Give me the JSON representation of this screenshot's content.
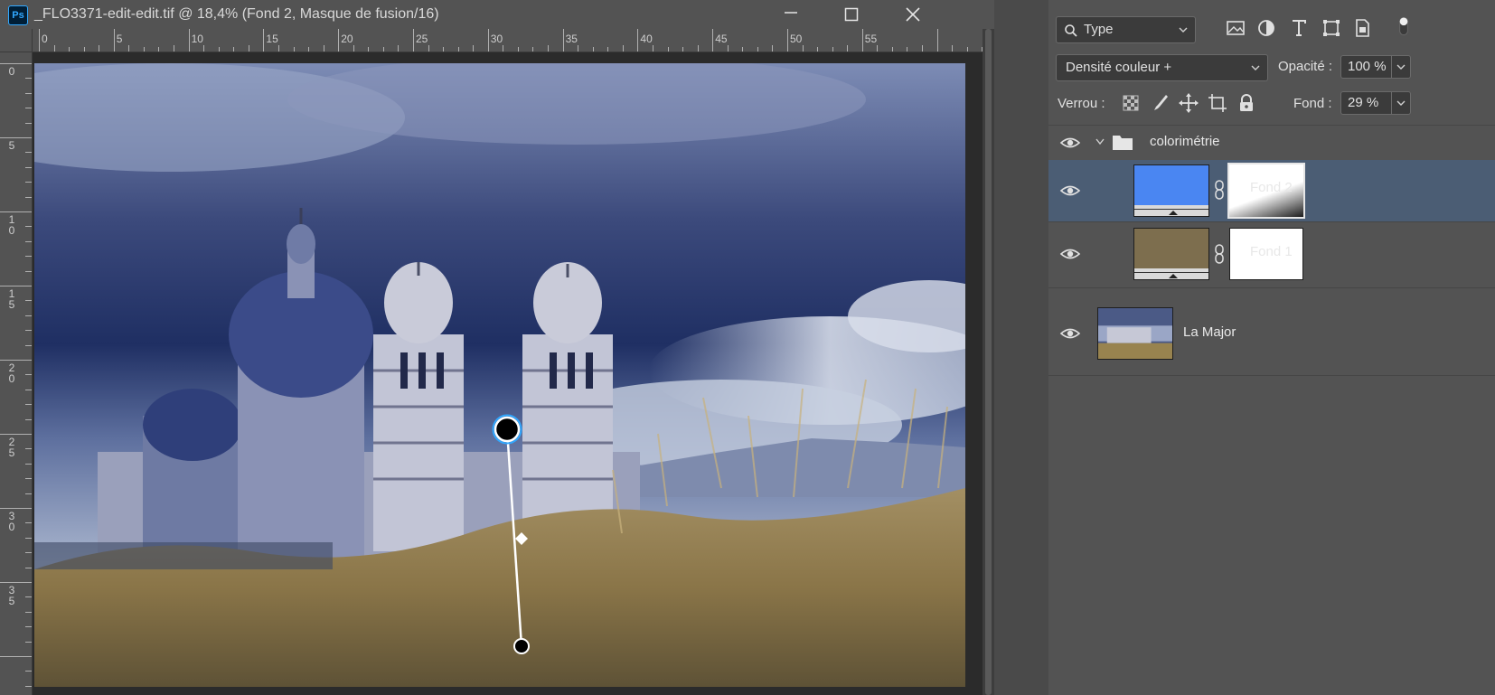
{
  "window": {
    "app_logo": "Ps",
    "title": "_FLO3371-edit-edit.tif @ 18,4% (Fond 2, Masque de fusion/16)",
    "controls": [
      "minimize-icon",
      "maximize-icon",
      "close-icon"
    ]
  },
  "rulers": {
    "top_labels": [
      "0",
      "5",
      "10",
      "15",
      "20",
      "25",
      "30",
      "35",
      "40",
      "45",
      "50",
      "55"
    ],
    "left_labels": [
      "0",
      "5",
      "10",
      "15",
      "20",
      "25",
      "30",
      "35"
    ]
  },
  "canvas": {
    "image_description": "La Major",
    "gradient_tool": "on-canvas gradient handles"
  },
  "layers_panel": {
    "filter": {
      "icon": "search-icon",
      "value": "Type"
    },
    "filter_icons": [
      "image-filter-icon",
      "adjustment-filter-icon",
      "type-filter-icon",
      "shape-filter-icon",
      "smartobject-filter-icon",
      "filter-toggle-icon"
    ],
    "blend_mode": "Densité couleur +",
    "opacity_label": "Opacité :",
    "opacity_value": "100 %",
    "lock_label": "Verrou :",
    "lock_icons": [
      "lock-transparent-icon",
      "lock-image-icon",
      "lock-position-icon",
      "lock-artboard-icon",
      "lock-all-icon"
    ],
    "fill_label": "Fond :",
    "fill_value": "29 %",
    "layers": [
      {
        "name": "colorimétrie",
        "type": "group",
        "visible": true
      },
      {
        "name": "Fond 2",
        "type": "fill",
        "color": "#4a86f2",
        "selected": true,
        "visible": true,
        "mask": "gradient"
      },
      {
        "name": "Fond 1",
        "type": "fill",
        "color": "#7d6e4e",
        "selected": false,
        "visible": true,
        "mask": "white"
      },
      {
        "name": "La Major",
        "type": "image",
        "selected": false,
        "visible": true
      }
    ]
  },
  "colors": {
    "accent": "#31a8ff",
    "selected_row": "#4b5d74",
    "panel_bg": "#535353"
  }
}
